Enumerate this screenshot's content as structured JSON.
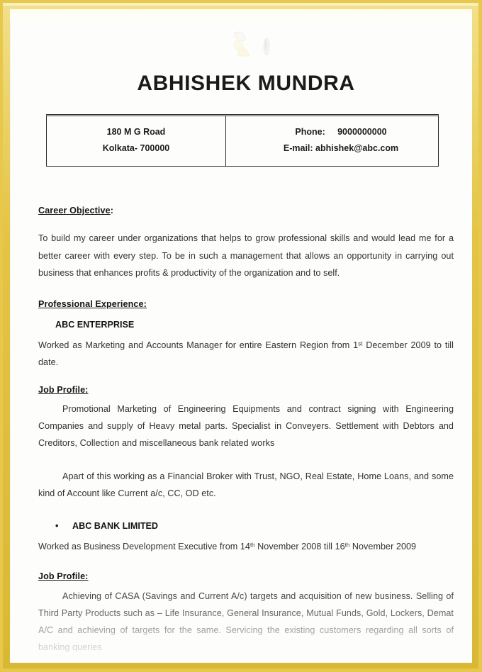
{
  "document": {
    "name_heading": "ABHISHEK MUNDRA",
    "watermark": "faint-logo-watermark"
  },
  "contact": {
    "address_line1": "180 M G Road",
    "address_line2": "Kolkata- 700000",
    "phone_line": "Phone:     9000000000",
    "email_line": "E-mail: abhishek@abc.com"
  },
  "career_objective": {
    "heading_label": "Career Objective",
    "heading_colon": ":",
    "body": "To build my career under organizations that helps to grow professional skills and would lead me for a better career with every step. To be in such a management that allows an opportunity in carrying out business that enhances profits & productivity of the organization and to self."
  },
  "professional_experience": {
    "heading": "Professional Experience:",
    "jobs": [
      {
        "company": "ABC ENTERPRISE",
        "bulleted": false,
        "summary_before": "Worked as Marketing and Accounts Manager for entire Eastern Region from 1",
        "summary_sup": "st",
        "summary_after": " December 2009 to till date.",
        "job_profile_heading": "Job Profile:",
        "job_profile_body": "Promotional Marketing of Engineering Equipments and contract signing with Engineering Companies and supply of Heavy metal parts. Specialist in Conveyers. Settlement with Debtors and Creditors, Collection and miscellaneous bank related works",
        "extra_paragraph": "Apart of this working as a Financial Broker with Trust, NGO, Real Estate, Home Loans, and some kind of Account like Current a/c, CC, OD etc."
      },
      {
        "company": "ABC BANK LIMITED",
        "bulleted": true,
        "bullet_glyph": "•",
        "summary_before": "Worked as Business Development Executive from 14",
        "summary_sup": "th",
        "summary_middle": " November 2008 till 16",
        "summary_sup2": "th",
        "summary_after": " November 2009",
        "job_profile_heading": "Job Profile:",
        "job_profile_body": "Achieving of CASA (Savings and Current A/c) targets and acquisition of new business. Selling of Third Party Products such as – Life Insurance, General Insurance, Mutual Funds, Gold, Lockers, Demat A/C and achieving of targets for the same. Servicing the existing customers regarding all sorts of banking queries"
      }
    ]
  },
  "colors": {
    "frame_gold": "#e3c444",
    "frame_gold_light": "#f2e08a",
    "paper": "#fdfdfb",
    "text": "#333132",
    "heading_text": "#151515"
  }
}
